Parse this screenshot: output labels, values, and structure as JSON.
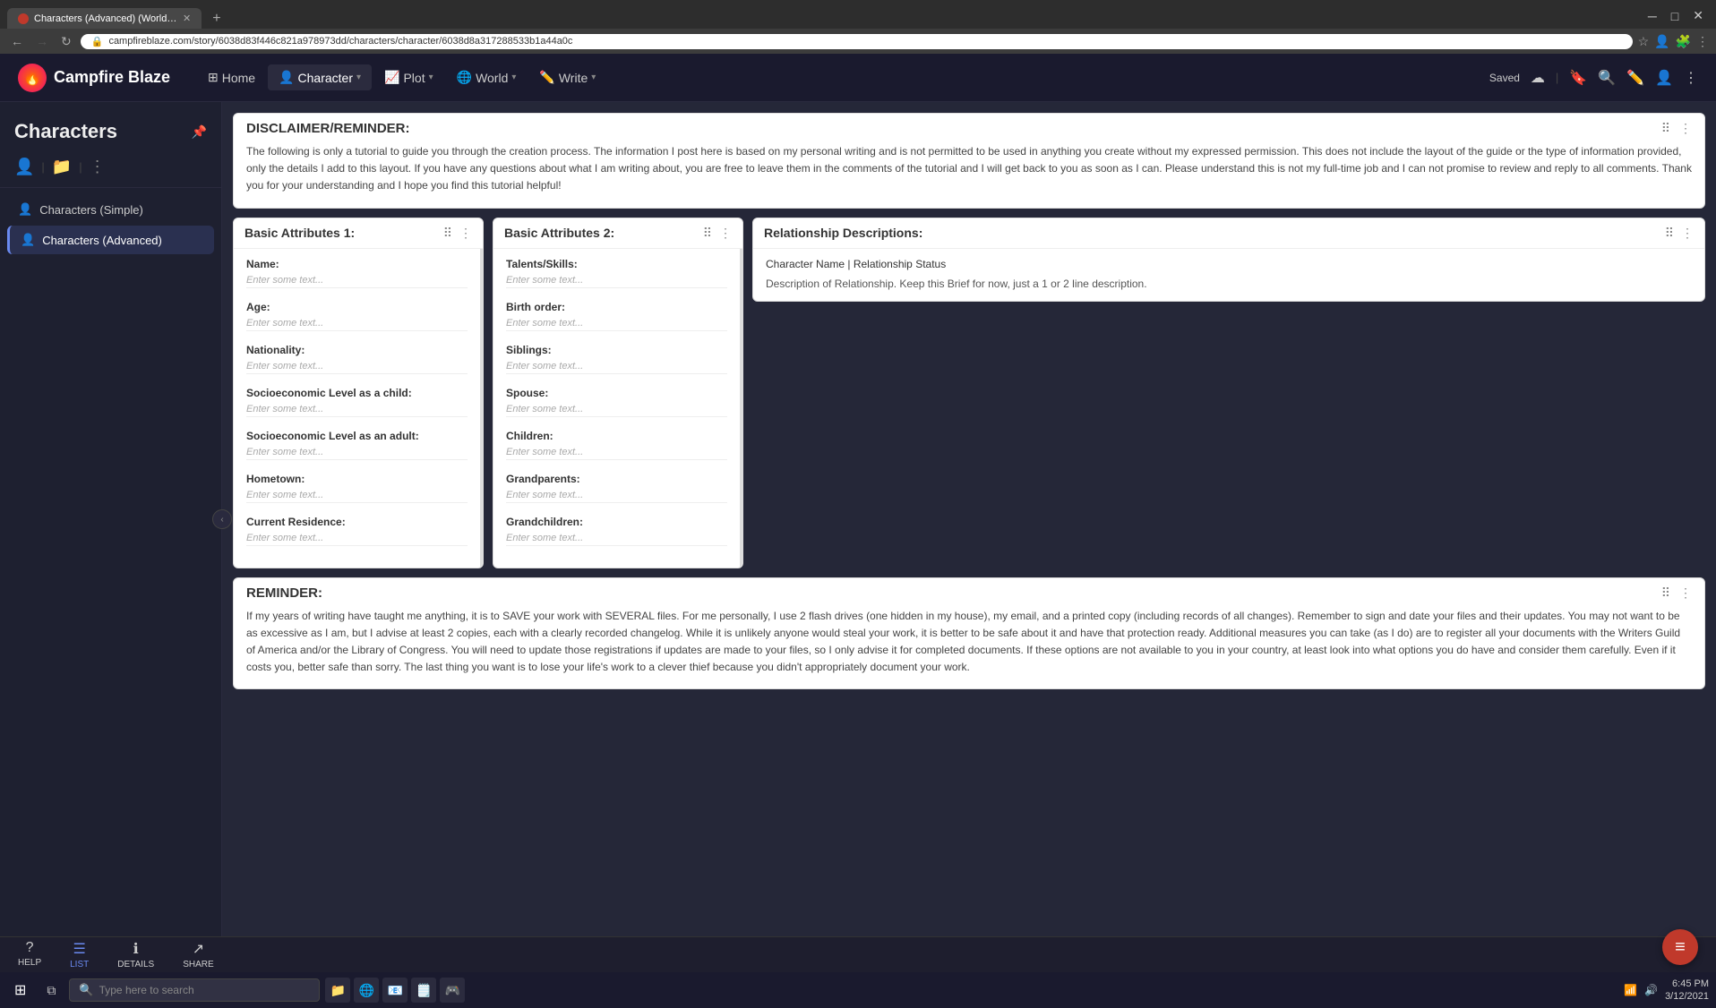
{
  "browser": {
    "tab_label": "Characters (Advanced) (World-b...",
    "tab_new_label": "+",
    "address": "campfireblaze.com/story/6038d83f446c821a978973dd/characters/character/6038d8a317288533b1a44a0c",
    "nav_back": "←",
    "nav_forward": "→",
    "nav_refresh": "↻",
    "saved_label": "Saved"
  },
  "app": {
    "logo_text": "🔥",
    "title": "Campfire Blaze",
    "nav": [
      {
        "id": "home",
        "label": "Home",
        "icon": "⊞",
        "has_dropdown": false
      },
      {
        "id": "character",
        "label": "Character",
        "icon": "👤",
        "has_dropdown": true,
        "active": true
      },
      {
        "id": "plot",
        "label": "Plot",
        "icon": "📈",
        "has_dropdown": true
      },
      {
        "id": "world",
        "label": "World",
        "icon": "🌐",
        "has_dropdown": true
      },
      {
        "id": "write",
        "label": "Write",
        "icon": "✏️",
        "has_dropdown": true
      }
    ]
  },
  "sidebar": {
    "title": "Characters",
    "items": [
      {
        "id": "simple",
        "label": "Characters (Simple)",
        "icon": "👤"
      },
      {
        "id": "advanced",
        "label": "Characters (Advanced)",
        "icon": "👤",
        "active": true
      }
    ]
  },
  "disclaimer_card": {
    "title": "DISCLAIMER/REMINDER:",
    "body": "The following is only a tutorial to guide you through the creation process. The information I post here is based on my personal writing and is not permitted to be used in anything you create without my expressed permission. This does not include the layout of the guide or the type of information provided, only the details I add to this layout. If you have any questions about what I am writing about, you are free to leave them in the comments of the tutorial and I will get back to you as soon as I can. Please understand this is not my full-time job and I can not promise to review and reply to all comments. Thank you for your understanding and I hope you find this tutorial helpful!"
  },
  "panels": {
    "basic1": {
      "title": "Basic Attributes 1:",
      "fields": [
        {
          "label": "Name:",
          "placeholder": "Enter some text..."
        },
        {
          "label": "Age:",
          "placeholder": "Enter some text..."
        },
        {
          "label": "Nationality:",
          "placeholder": "Enter some text..."
        },
        {
          "label": "Socioeconomic Level as a child:",
          "placeholder": "Enter some text..."
        },
        {
          "label": "Socioeconomic Level as an adult:",
          "placeholder": "Enter some text..."
        },
        {
          "label": "Hometown:",
          "placeholder": "Enter some text..."
        },
        {
          "label": "Current Residence:",
          "placeholder": "Enter some text..."
        }
      ]
    },
    "basic2": {
      "title": "Basic Attributes 2:",
      "fields": [
        {
          "label": "Talents/Skills:",
          "placeholder": "Enter some text..."
        },
        {
          "label": "Birth order:",
          "placeholder": "Enter some text..."
        },
        {
          "label": "Siblings:",
          "placeholder": "Enter some text..."
        },
        {
          "label": "Spouse:",
          "placeholder": "Enter some text..."
        },
        {
          "label": "Children:",
          "placeholder": "Enter some text..."
        },
        {
          "label": "Grandparents:",
          "placeholder": "Enter some text..."
        },
        {
          "label": "Grandchildren:",
          "placeholder": "Enter some text..."
        }
      ]
    },
    "rel_desc": {
      "title": "Relationship Descriptions:",
      "header_line": "Character Name | Relationship Status",
      "desc_line": "Description of Relationship. Keep this Brief for now, just a 1 or 2 line description."
    }
  },
  "reminder_card": {
    "title": "REMINDER:",
    "body": "If my years of writing have taught me anything, it is to SAVE your work with SEVERAL files. For me personally, I use 2 flash drives (one hidden in my house), my email, and a printed copy (including records of all changes). Remember to sign and date your files and their updates. You may not want to be as excessive as I am, but I advise at least 2 copies, each with a clearly recorded changelog. While it is unlikely anyone would steal your work, it is better to be safe about it and have that protection ready. Additional measures you can take (as I do) are to register all your documents with the Writers Guild of America and/or the Library of Congress. You will need to update those registrations if updates are made to your files, so I only advise it for completed documents. If these options are not available to you in your country, at least look into what options you do have and consider them carefully. Even if it costs you, better safe than sorry. The last thing you want is to lose your life's work to a clever thief because you didn't appropriately document your work."
  },
  "bottom_bar": {
    "actions": [
      {
        "id": "help",
        "label": "HELP",
        "icon": "?"
      },
      {
        "id": "list",
        "label": "LIST",
        "icon": "☰",
        "active": true
      },
      {
        "id": "details",
        "label": "DETAILS",
        "icon": "ℹ"
      },
      {
        "id": "share",
        "label": "SHARE",
        "icon": "↗"
      }
    ]
  },
  "win_taskbar": {
    "search_placeholder": "Type here to search",
    "clock_time": "6:45 PM",
    "clock_date": "3/12/2021"
  }
}
